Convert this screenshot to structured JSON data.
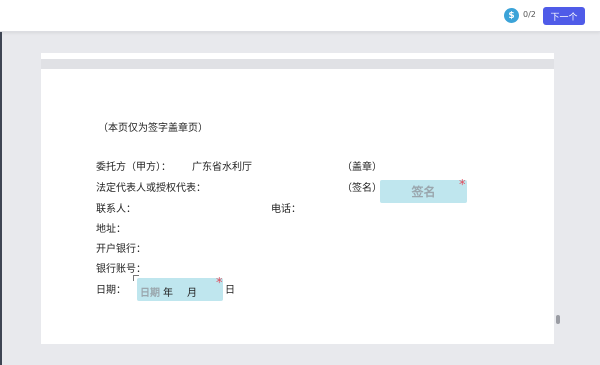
{
  "header": {
    "sign_badge_icon": "signature-icon",
    "sign_badge_glyph": "$",
    "sign_count": "0/2",
    "next_button_label": "下一个"
  },
  "document": {
    "note": "（本页仅为签字盖章页）",
    "client_label": "委托方（甲方）：",
    "client_value": "广东省水利厅",
    "seal_label": "（盖章）",
    "legal_rep_label": "法定代表人或授权代表：",
    "sign_label": "（签名）",
    "contact_label": "联系人：",
    "phone_label": "电话：",
    "address_label": "地址：",
    "bank_label": "开户银行：",
    "account_label": "银行账号：",
    "date_label": "日期：",
    "day_suffix": "日"
  },
  "fields": {
    "signature_placeholder": "签名",
    "date_placeholder": "日期",
    "date_year": "年",
    "date_month": "月",
    "required_mark": "*"
  },
  "colors": {
    "accent_button": "#4f5be8",
    "badge": "#3ba3d8",
    "field_bg": "#bfe6ee",
    "required": "#e24b5a"
  }
}
